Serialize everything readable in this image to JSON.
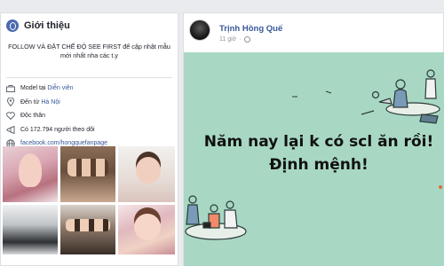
{
  "intro": {
    "title": "Giới thiệu",
    "description": "FOLLOW VÀ ĐẶT CHẾ ĐỘ SEE FIRST để cập nhật mẫu mới nhất nha các t.y",
    "items": [
      {
        "icon": "briefcase-icon",
        "prefix": "Model tại ",
        "link": "Diễn viên"
      },
      {
        "icon": "location-pin-icon",
        "prefix": "Đến từ ",
        "link": "Hà Nội"
      },
      {
        "icon": "heart-icon",
        "prefix": "Độc thân",
        "link": ""
      },
      {
        "icon": "followers-icon",
        "prefix": "Có 172.794 người theo dõi",
        "link": ""
      },
      {
        "icon": "web-globe-icon",
        "prefix": "",
        "link": "facebook.com/hongquefanpage"
      }
    ]
  },
  "post": {
    "author": "Trịnh Hồng Quế",
    "time": "11 giờ",
    "banner_line1": "Năm nay lại k có scl ăn rồi!",
    "banner_line2": "Định mệnh!"
  },
  "colors": {
    "page_bg": "#e9ebee",
    "link": "#385898",
    "banner_bg": "#a8d8c3",
    "facebook_blue": "#4b69b0"
  }
}
